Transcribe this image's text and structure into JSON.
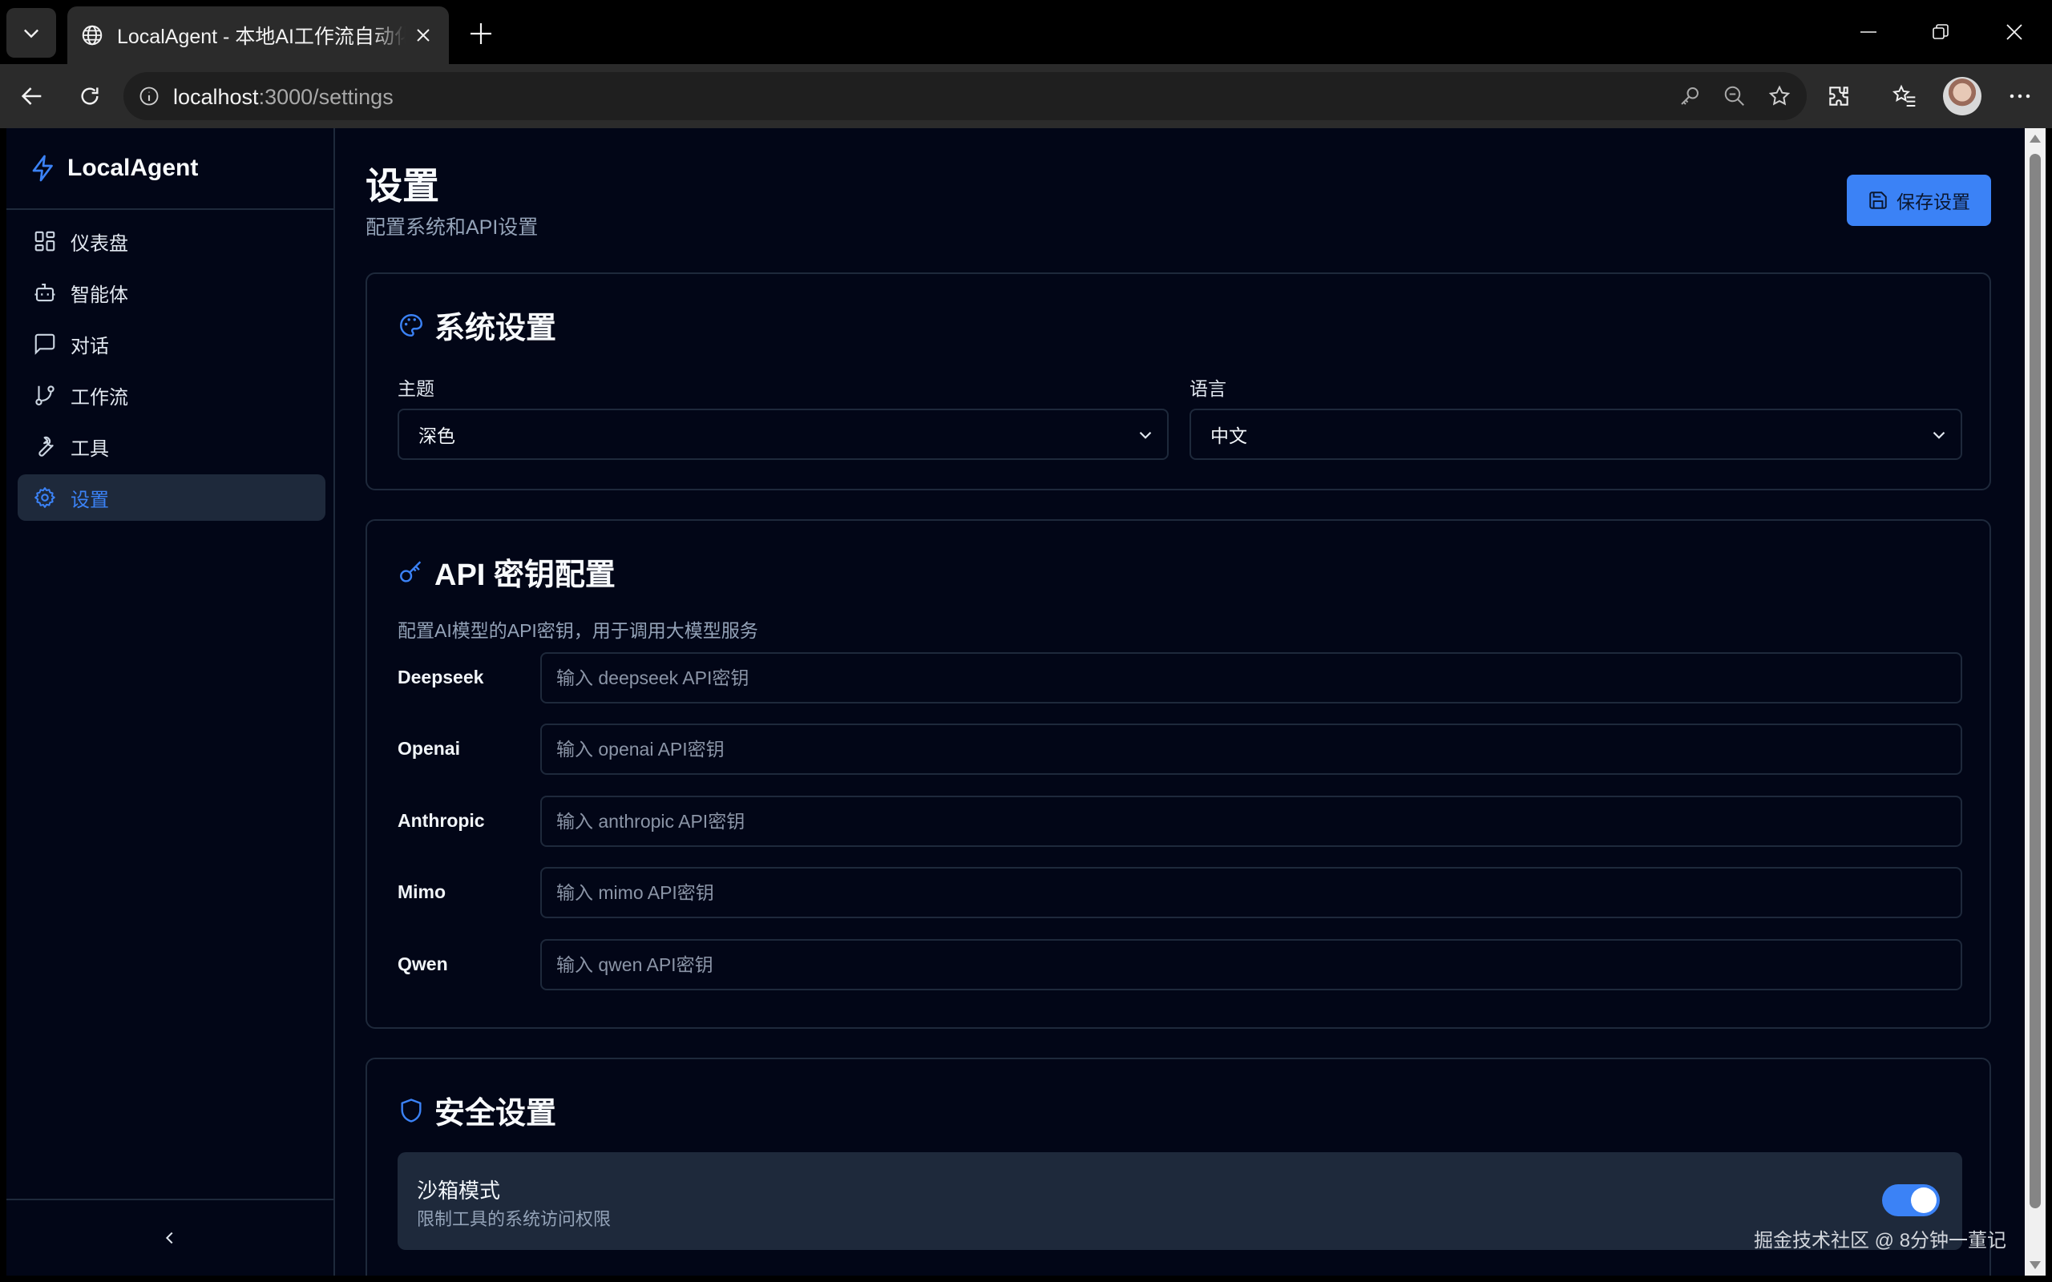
{
  "browser": {
    "tab_title": "LocalAgent - 本地AI工作流自动化工具",
    "url_host": "localhost",
    "url_path": ":3000/settings"
  },
  "sidebar": {
    "brand": "LocalAgent",
    "items": [
      {
        "label": "仪表盘",
        "icon": "dashboard-icon"
      },
      {
        "label": "智能体",
        "icon": "bot-icon"
      },
      {
        "label": "对话",
        "icon": "chat-icon"
      },
      {
        "label": "工作流",
        "icon": "workflow-icon"
      },
      {
        "label": "工具",
        "icon": "wrench-icon"
      },
      {
        "label": "设置",
        "icon": "gear-icon",
        "active": true
      }
    ]
  },
  "header": {
    "title": "设置",
    "subtitle": "配置系统和API设置",
    "save_label": "保存设置"
  },
  "system": {
    "title": "系统设置",
    "theme_label": "主题",
    "theme_value": "深色",
    "language_label": "语言",
    "language_value": "中文"
  },
  "api": {
    "title": "API 密钥配置",
    "description": "配置AI模型的API密钥，用于调用大模型服务",
    "providers": [
      {
        "name": "Deepseek",
        "placeholder": "输入 deepseek API密钥"
      },
      {
        "name": "Openai",
        "placeholder": "输入 openai API密钥"
      },
      {
        "name": "Anthropic",
        "placeholder": "输入 anthropic API密钥"
      },
      {
        "name": "Mimo",
        "placeholder": "输入 mimo API密钥"
      },
      {
        "name": "Qwen",
        "placeholder": "输入 qwen API密钥"
      }
    ]
  },
  "security": {
    "title": "安全设置",
    "sandbox_title": "沙箱模式",
    "sandbox_desc": "限制工具的系统访问权限",
    "sandbox_enabled": true
  },
  "watermark": "掘金技术社区 @ 8分钟一董记",
  "colors": {
    "accent": "#3b82f6",
    "background": "#020617",
    "border": "#1e293b"
  }
}
